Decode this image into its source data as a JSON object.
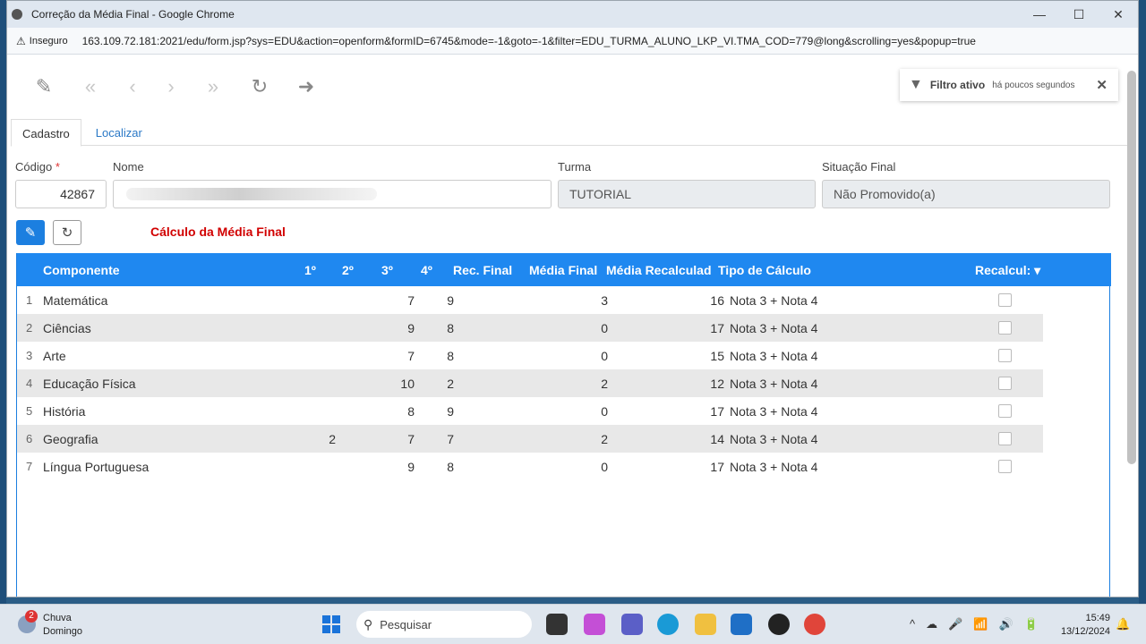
{
  "browser": {
    "title": "Correção da Média Final - Google Chrome",
    "insecure_label": "Inseguro",
    "url": "163.109.72.181:2021/edu/form.jsp?sys=EDU&action=openform&formID=6745&mode=-1&goto=-1&filter=EDU_TURMA_ALUNO_LKP_VI.TMA_COD=779@long&scrolling=yes&popup=true",
    "minimize": "—",
    "maximize": "☐",
    "close": "✕"
  },
  "toolbar": {
    "edit": "✎",
    "first": "«",
    "prev": "‹",
    "next": "›",
    "last": "»",
    "reload": "↻",
    "exit": "➜"
  },
  "filter": {
    "label": "Filtro ativo",
    "time": "há poucos segundos",
    "close": "✕"
  },
  "tabs": [
    "Cadastro",
    "Localizar"
  ],
  "form": {
    "codigo_label": "Código",
    "codigo_required": "*",
    "codigo_value": "42867",
    "nome_label": "Nome",
    "turma_label": "Turma",
    "turma_value": "TUTORIAL",
    "situacao_label": "Situação Final",
    "situacao_value": "Não Promovido(a)"
  },
  "section": {
    "title": "Cálculo da Média Final",
    "edit_icon": "✎",
    "refresh_icon": "↻"
  },
  "grid": {
    "headers": {
      "componente": "Componente",
      "b1": "1º",
      "b2": "2º",
      "b3": "3º",
      "b4": "4º",
      "rec": "Rec. Final",
      "media": "Média Final",
      "recalc": "Média Recalculad",
      "tipo": "Tipo de Cálculo",
      "recalcular": "Recalcul: ▾"
    },
    "rows": [
      {
        "idx": "1",
        "componente": "Matemática",
        "b2": "",
        "b3": "7",
        "b4": "9",
        "media": "3",
        "recalc": "16",
        "tipo": "Nota 3 + Nota 4"
      },
      {
        "idx": "2",
        "componente": "Ciências",
        "b2": "",
        "b3": "9",
        "b4": "8",
        "media": "0",
        "recalc": "17",
        "tipo": "Nota 3 + Nota 4"
      },
      {
        "idx": "3",
        "componente": "Arte",
        "b2": "",
        "b3": "7",
        "b4": "8",
        "media": "0",
        "recalc": "15",
        "tipo": "Nota 3 + Nota 4"
      },
      {
        "idx": "4",
        "componente": "Educação Física",
        "b2": "",
        "b3": "10",
        "b4": "2",
        "media": "2",
        "recalc": "12",
        "tipo": "Nota 3 + Nota 4"
      },
      {
        "idx": "5",
        "componente": "História",
        "b2": "",
        "b3": "8",
        "b4": "9",
        "media": "0",
        "recalc": "17",
        "tipo": "Nota 3 + Nota 4"
      },
      {
        "idx": "6",
        "componente": "Geografia",
        "b2": "2",
        "b3": "7",
        "b4": "7",
        "media": "2",
        "recalc": "14",
        "tipo": "Nota 3 + Nota 4"
      },
      {
        "idx": "7",
        "componente": "Língua Portuguesa",
        "b2": "",
        "b3": "9",
        "b4": "8",
        "media": "0",
        "recalc": "17",
        "tipo": "Nota 3 + Nota 4"
      }
    ]
  },
  "taskbar": {
    "weather_badge": "2",
    "weather_line1": "Chuva",
    "weather_line2": "Domingo",
    "search_placeholder": "Pesquisar",
    "search_icon": "⚲",
    "time": "15:49",
    "date": "13/12/2024",
    "tray_icons": [
      "^",
      "☁",
      "🎤",
      "📶",
      "🔊",
      "🔋"
    ],
    "bell": "🔔"
  }
}
